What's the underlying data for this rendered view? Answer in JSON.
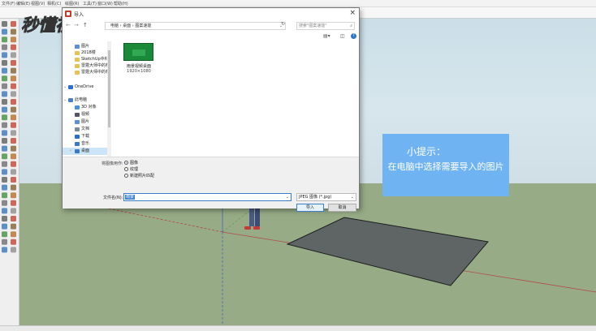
{
  "app": {
    "menu": [
      "文件(F)",
      "编辑(E)",
      "视图(V)",
      "相机(C)",
      "绘图(R)",
      "工具(T)",
      "窗口(W)",
      "帮助(H)"
    ]
  },
  "watermark": {
    "text": "秒懂视频"
  },
  "dialog": {
    "title": "导入",
    "breadcrumb": "电脑 › 桌面 › 图案速能",
    "search_placeholder": "搜索\"图案速能\"",
    "nav": [
      {
        "label": "图片",
        "icon": "image-folder-icon",
        "color": "#5c8fd6",
        "indent": 1
      },
      {
        "label": "2018楼",
        "icon": "folder-icon",
        "color": "#e8c15a",
        "indent": 1
      },
      {
        "label": "SketchUp中材质",
        "icon": "folder-icon",
        "color": "#e8c15a",
        "indent": 1
      },
      {
        "label": "雷霆大师中的材",
        "icon": "folder-icon",
        "color": "#e8c15a",
        "indent": 1
      },
      {
        "label": "雷霆大师中的材",
        "icon": "folder-icon",
        "color": "#e8c15a",
        "indent": 1
      },
      {
        "label": "OneDrive",
        "icon": "cloud-icon",
        "color": "#2a6fc9",
        "indent": 0
      },
      {
        "label": "此电脑",
        "icon": "computer-icon",
        "color": "#4a7fc0",
        "indent": 0
      },
      {
        "label": "3D 对象",
        "icon": "3d-objects-icon",
        "color": "#4a8fd8",
        "indent": 1
      },
      {
        "label": "视频",
        "icon": "video-icon",
        "color": "#556",
        "indent": 1
      },
      {
        "label": "图片",
        "icon": "pictures-icon",
        "color": "#5c8fd6",
        "indent": 1
      },
      {
        "label": "文档",
        "icon": "documents-icon",
        "color": "#7a8a9a",
        "indent": 1
      },
      {
        "label": "下载",
        "icon": "downloads-icon",
        "color": "#2a6fc9",
        "indent": 1
      },
      {
        "label": "音乐",
        "icon": "music-icon",
        "color": "#3a78c8",
        "indent": 1
      },
      {
        "label": "桌面",
        "icon": "desktop-icon",
        "color": "#3a78c8",
        "indent": 1,
        "selected": true
      }
    ],
    "file": {
      "name": "雨景视频桌面",
      "size": "1920×1080"
    },
    "options_label": "将图像用作:",
    "options": [
      {
        "label": "图像",
        "checked": true
      },
      {
        "label": "纹理",
        "checked": false
      },
      {
        "label": "新建照片匹配",
        "checked": false
      }
    ],
    "filename_label": "文件名(N):",
    "filename_value": "雨景",
    "filetype": "JPEG 图像 (*.jpg)",
    "import_label": "导入",
    "cancel_label": "取消"
  },
  "hint": {
    "title": "小提示：",
    "body": "在电脑中选择需要导入的图片"
  }
}
